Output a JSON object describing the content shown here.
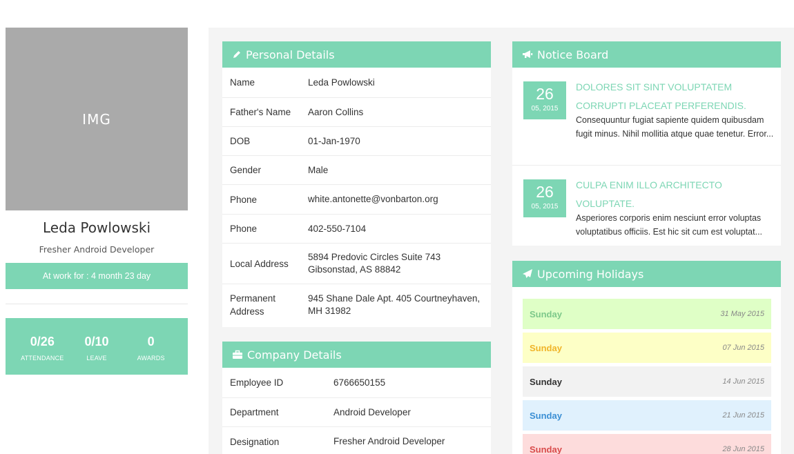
{
  "profile": {
    "img_label": "IMG",
    "name": "Leda Powlowski",
    "role": "Fresher Android Developer",
    "work_for": "At work for : 4 month 23 day",
    "stats": [
      {
        "value": "0/26",
        "label": "ATTENDANCE"
      },
      {
        "value": "0/10",
        "label": "LEAVE"
      },
      {
        "value": "0",
        "label": "AWARDS"
      }
    ]
  },
  "personal": {
    "title": "Personal Details",
    "rows": [
      {
        "label": "Name",
        "value": "Leda Powlowski"
      },
      {
        "label": "Father's Name",
        "value": "Aaron Collins"
      },
      {
        "label": "DOB",
        "value": "01-Jan-1970"
      },
      {
        "label": "Gender",
        "value": "Male"
      },
      {
        "label": "Phone",
        "value": "white.antonette@vonbarton.org"
      },
      {
        "label": "Phone",
        "value": "402-550-7104"
      },
      {
        "label": "Local Address",
        "value": "5894 Predovic Circles Suite 743 Gibsonstad, AS 88842"
      },
      {
        "label": "Permanent Address",
        "value": "945 Shane Dale Apt. 405 Courtneyhaven, MH 31982"
      }
    ]
  },
  "company": {
    "title": "Company Details",
    "rows": [
      {
        "label": "Employee ID",
        "value": "6766650155"
      },
      {
        "label": "Department",
        "value": "Android Developer"
      },
      {
        "label": "Designation",
        "value": "Fresher Android Developer"
      }
    ]
  },
  "notices": {
    "title": "Notice Board",
    "items": [
      {
        "day": "26",
        "month": "05, 2015",
        "title": "DOLORES SIT SINT VOLUPTATEM CORRUPTI PLACEAT PERFERENDIS.",
        "text": "Consequuntur fugiat sapiente quidem quibusdam fugit minus. Nihil mollitia atque quae tenetur. Error..."
      },
      {
        "day": "26",
        "month": "05, 2015",
        "title": "CULPA ENIM ILLO ARCHITECTO VOLUPTATE.",
        "text": "Asperiores corporis enim nesciunt error voluptas voluptatibus officiis. Est hic sit cum est voluptat..."
      }
    ]
  },
  "holidays": {
    "title": "Upcoming Holidays",
    "items": [
      {
        "day": "Sunday",
        "date": "31 May 2015",
        "bg": "#dfffc6",
        "color": "#7dc88a"
      },
      {
        "day": "Sunday",
        "date": "07 Jun 2015",
        "bg": "#fdffc6",
        "color": "#f0b429"
      },
      {
        "day": "Sunday",
        "date": "14 Jun 2015",
        "bg": "#f2f2f2",
        "color": "#333333"
      },
      {
        "day": "Sunday",
        "date": "21 Jun 2015",
        "bg": "#e0f1fd",
        "color": "#3b8fd4"
      },
      {
        "day": "Sunday",
        "date": "28 Jun 2015",
        "bg": "#fddcdc",
        "color": "#d94b4b"
      }
    ]
  },
  "colors": {
    "accent": "#7dd6b4",
    "placeholder": "#aaaaaa",
    "panel_bg": "#f4f4f4"
  }
}
